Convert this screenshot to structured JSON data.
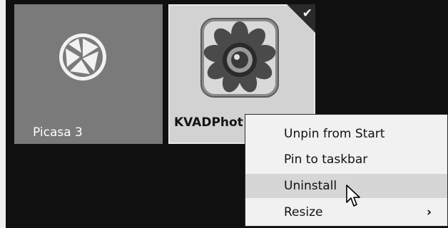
{
  "tiles": [
    {
      "label": "Picasa 3",
      "icon": "picasa-aperture-icon",
      "color": "#7a7a7a"
    },
    {
      "label": "KVADPhot",
      "icon": "kvadphoto-flower-lens-icon",
      "color": "#d2d2d2",
      "selected": true
    }
  ],
  "context_menu": {
    "items": [
      {
        "label": "Unpin from Start"
      },
      {
        "label": "Pin to taskbar"
      },
      {
        "label": "Uninstall",
        "highlighted": true
      },
      {
        "label": "Resize",
        "submenu_icon": "chevron-right-icon"
      }
    ]
  },
  "colors": {
    "background": "#101010",
    "menu_bg": "#f1f1f1",
    "menu_highlight": "#d6d6d6"
  }
}
